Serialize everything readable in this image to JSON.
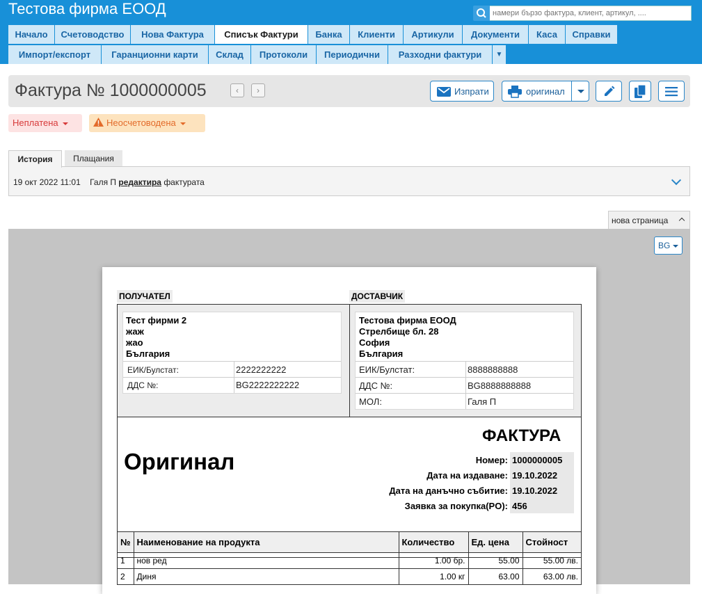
{
  "app": {
    "company": "Тестова фирма ЕООД"
  },
  "search": {
    "placeholder": "намери бързо фактура, клиент, артикул, ...."
  },
  "menu": {
    "row1": [
      "Начало",
      "Счетоводство",
      "Нова Фактура",
      "Списък Фактури",
      "Банка",
      "Клиенти",
      "Артикули",
      "Документи",
      "Каса",
      "Справки"
    ],
    "row2": [
      "Импорт/експорт",
      "Гаранционни карти",
      "Склад",
      "Протоколи",
      "Периодични",
      "Разходни фактури"
    ],
    "active": "Списък Фактури"
  },
  "invoice_header": {
    "title": "Фактура № 1000000005",
    "send_label": "Изпрати",
    "print_label": "оригинал"
  },
  "status": {
    "payment": "Неплатена",
    "accounting": "Неосчетоводена"
  },
  "tabs": {
    "history": "История",
    "payments": "Плащания"
  },
  "history": {
    "timestamp": "19 окт 2022 11:01",
    "user": "Галя П",
    "action": "редактира",
    "object": "фактурата"
  },
  "preview": {
    "new_page": "нова страница",
    "lang": "BG"
  },
  "invoice": {
    "recipient_label": "ПОЛУЧАТЕЛ",
    "supplier_label": "ДОСТАВЧИК",
    "recipient": {
      "name": "Тест фирми 2",
      "line2": "жаж",
      "line3": "жао",
      "country": "България",
      "eik_label": "ЕИК/Булстат:",
      "eik": "2222222222",
      "vat_label": "ДДС №:",
      "vat": "BG2222222222"
    },
    "supplier": {
      "name": "Тестова фирма ЕООД",
      "address": "Стрелбище бл. 28",
      "city": "София",
      "country": "България",
      "eik_label": "ЕИК/Булстат:",
      "eik": "8888888888",
      "vat_label": "ДДС №:",
      "vat": "BG8888888888",
      "mol_label": "МОЛ:",
      "mol": "Галя П"
    },
    "doc_type": "ФАКТУРА",
    "copy_type": "Оригинал",
    "number_label": "Номер:",
    "number": "1000000005",
    "issue_label": "Дата на издаване:",
    "issue_date": "19.10.2022",
    "tax_label": "Дата на данъчно събитие:",
    "tax_date": "19.10.2022",
    "po_label": "Заявка за покупка(PO):",
    "po": "456",
    "columns": [
      "№",
      "Наименование на продукта",
      "Количество",
      "Ед. цена",
      "Стойност"
    ],
    "items": [
      {
        "no": "1",
        "name": "нов ред",
        "qty": "1.00 бр.",
        "price": "55.00",
        "total": "55.00 лв."
      },
      {
        "no": "2",
        "name": "Диня",
        "qty": "1.00 кг",
        "price": "63.00",
        "total": "63.00 лв."
      }
    ]
  }
}
